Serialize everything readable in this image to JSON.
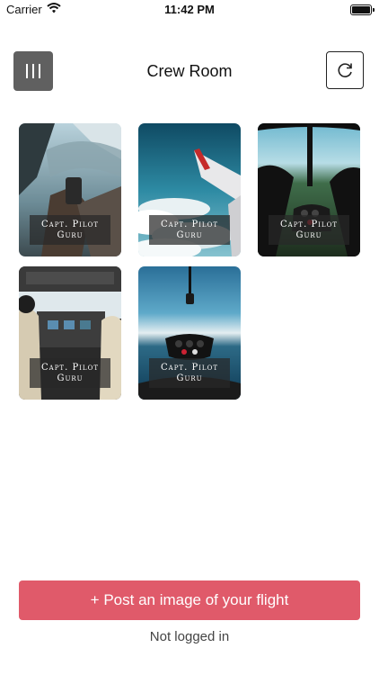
{
  "status_bar": {
    "carrier": "Carrier",
    "time": "11:42 PM"
  },
  "header": {
    "title": "Crew Room",
    "menu_icon": "menu-icon",
    "refresh_icon": "refresh-icon"
  },
  "posts": [
    {
      "label_line1": "Capt. Pilot",
      "label_line2": "Guru",
      "scene": "cockpit-window-view"
    },
    {
      "label_line1": "Capt. Pilot",
      "label_line2": "Guru",
      "scene": "airplane-wing-over-clouds"
    },
    {
      "label_line1": "Capt. Pilot",
      "label_line2": "Guru",
      "scene": "helicopter-view-over-island"
    },
    {
      "label_line1": "Capt. Pilot",
      "label_line2": "Guru",
      "scene": "pilots-in-cockpit"
    },
    {
      "label_line1": "Capt. Pilot",
      "label_line2": "Guru",
      "scene": "helicopter-over-ocean"
    }
  ],
  "footer": {
    "post_button_label": "+ Post an image of your flight",
    "login_status": "Not logged in"
  },
  "colors": {
    "accent": "#e05a6a",
    "menu_button": "#606060"
  }
}
